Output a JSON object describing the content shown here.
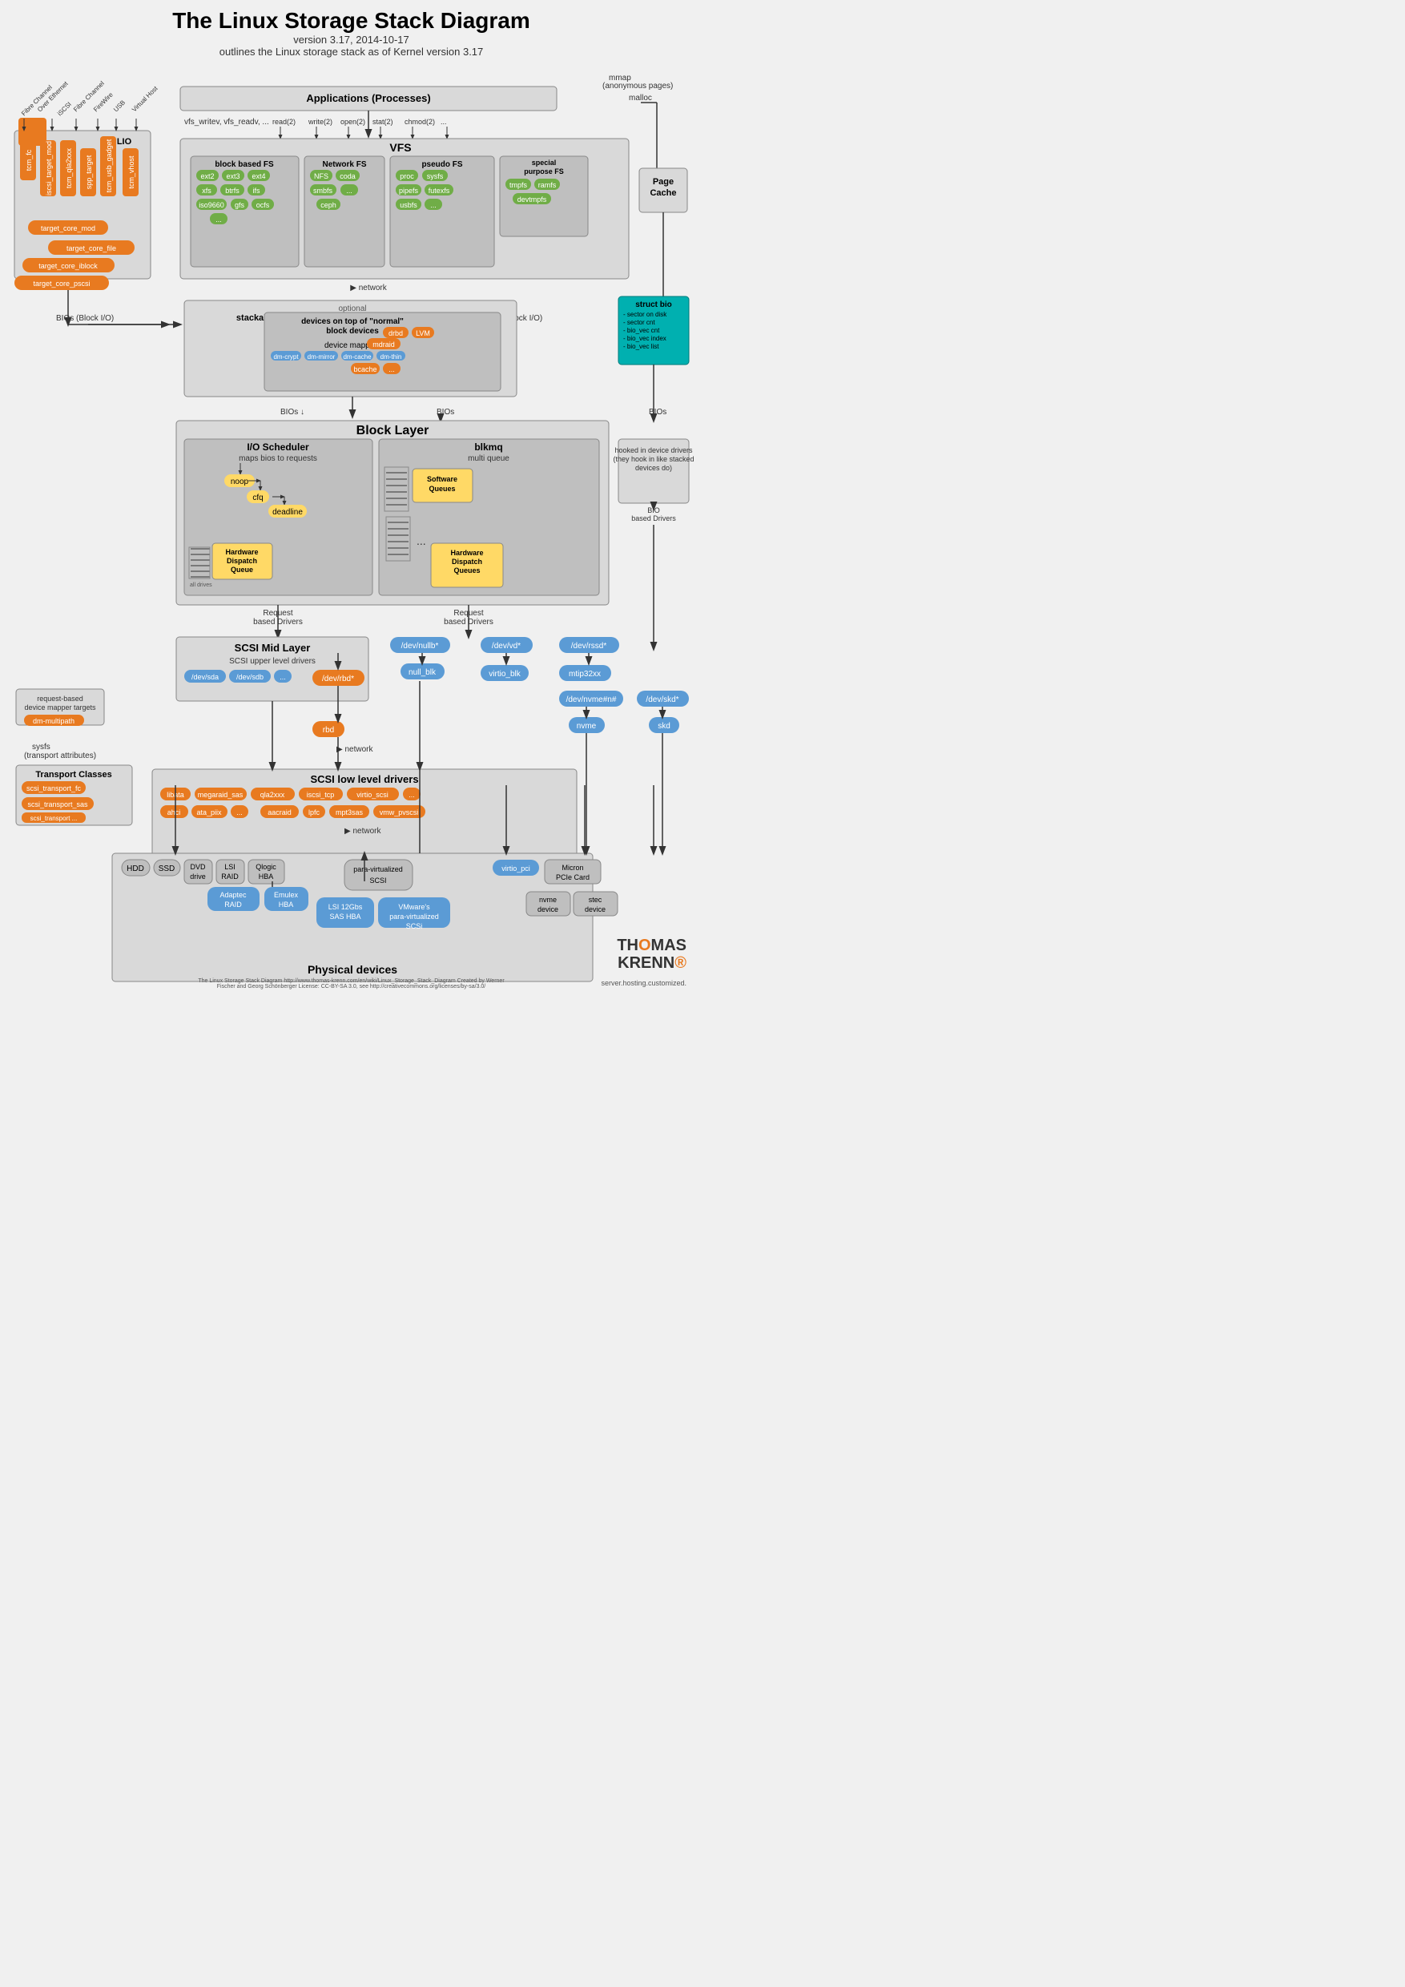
{
  "title": "The Linux Storage Stack Diagram",
  "version": "version 3.17, 2014-10-17",
  "subtitle": "outlines the Linux storage stack as of Kernel version 3.17",
  "sections": {
    "applications": "Applications (Processes)",
    "vfs": "VFS",
    "block_layer": "Block Layer",
    "io_scheduler": "I/O Scheduler",
    "blkmq": "blkmq",
    "scsi_mid": "SCSI Mid Layer",
    "scsi_low": "SCSI low level drivers",
    "physical": "Physical devices",
    "lio": "LIO",
    "page_cache": "Page\nCache"
  },
  "footer": {
    "logo": "THOMAS\nKRENN",
    "tagline": "server.hosting.customized.",
    "credits": "The Linux Storage Stack Diagram\nhttp://www.thomas-krenn.com/en/wiki/Linux_Storage_Stack_Diagram\nCreated by Werner Fischer and Georg Schönberger\nLicense: CC-BY-SA 3.0, see http://creativecommons.org/licenses/by-sa/3.0/"
  }
}
